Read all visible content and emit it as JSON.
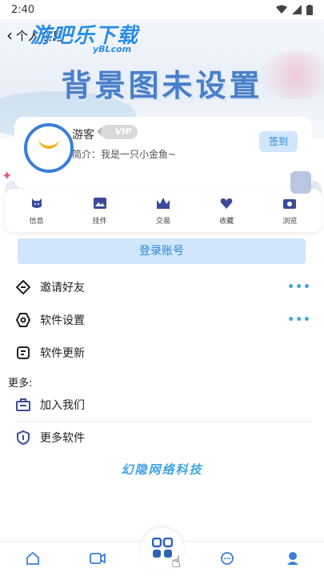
{
  "status_bar": {
    "time": "2:40"
  },
  "header": {
    "back_icon": "back-arrow-icon",
    "title": "个人信息"
  },
  "watermark": {
    "main": "游吧乐下载",
    "sub": "yBLcom"
  },
  "banner": {
    "title": "背景图未设置"
  },
  "profile": {
    "username": "游客",
    "vip_label": "VIP",
    "intro": "简介：我是一只小金鱼~",
    "checkin_label": "签到"
  },
  "quick_menu": [
    {
      "label": "信息",
      "icon": "cat-icon"
    },
    {
      "label": "挂件",
      "icon": "image-icon"
    },
    {
      "label": "交易",
      "icon": "crown-icon"
    },
    {
      "label": "收藏",
      "icon": "heart-icon"
    },
    {
      "label": "浏览",
      "icon": "camera-icon"
    }
  ],
  "login_label": "登录账号",
  "menu": [
    {
      "label": "邀请好友",
      "icon": "share-icon",
      "more": "•••"
    },
    {
      "label": "软件设置",
      "icon": "hexagon-settings-icon",
      "more": "•••"
    },
    {
      "label": "软件更新",
      "icon": "update-icon"
    }
  ],
  "more_header": "更多:",
  "more_menu": [
    {
      "label": "加入我们",
      "icon": "join-icon"
    },
    {
      "label": "更多软件",
      "icon": "shield-icon"
    }
  ],
  "company": "幻隐网络科技",
  "bottom_nav": [
    {
      "icon": "home-icon"
    },
    {
      "icon": "video-icon"
    },
    {
      "icon": "apps-icon"
    },
    {
      "icon": "chat-icon"
    },
    {
      "icon": "profile-icon"
    }
  ],
  "colors": {
    "accent": "#3b7ed8",
    "light_accent": "#cfe6fb",
    "link": "#2f86d6"
  }
}
